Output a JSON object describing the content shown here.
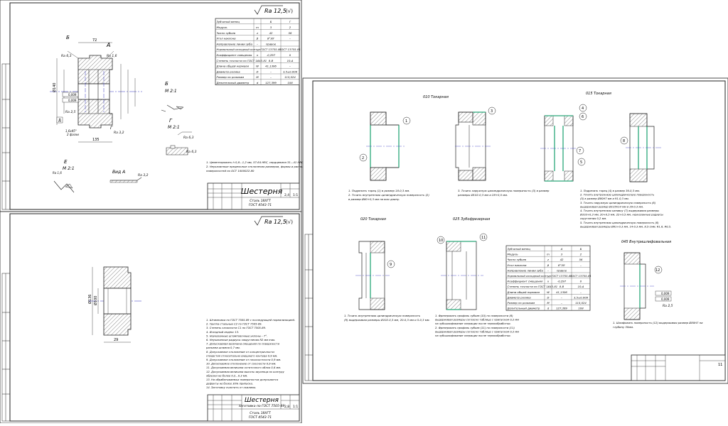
{
  "sheet1": {
    "roughness": "Ra 12,5",
    "roughness_paren": "(√)",
    "gear_table": {
      "header": [
        "Зубчатый венец",
        "",
        "Б",
        "Г"
      ],
      "rows": [
        [
          "Модуль",
          "m",
          "3",
          "2"
        ],
        [
          "Число зубьев",
          "z",
          "42",
          "56"
        ],
        [
          "Угол наклона",
          "β",
          "8°30'",
          "–"
        ],
        [
          "Направление линии зуба",
          "–",
          "правое",
          ""
        ],
        [
          "Нормальный исходный контур",
          "–",
          "ГОСТ 13755-81",
          "ГОСТ 13755-81"
        ],
        [
          "Коэффициент смещения",
          "x",
          "-0,297",
          "0"
        ],
        [
          "Степень точности по ГОСТ 1643-81",
          "–",
          "8-В",
          "10-А"
        ],
        [
          "Длина общей нормали",
          "W",
          "41,1306",
          "–"
        ],
        [
          "Диаметр ролика",
          "D",
          "–",
          "3,5±0,009"
        ],
        [
          "Размер по роликам",
          "M",
          "–",
          "115,024"
        ],
        [
          "Делительный диаметр",
          "d",
          "127,399",
          "108"
        ]
      ]
    },
    "labels": {
      "view_b": "Б",
      "view_a": "А",
      "section_g": "Г",
      "m21_1": "М 2:1",
      "m21_2": "М 2:1",
      "m21_3": "М 2:1",
      "view_b_label": "Вид А",
      "view_d": "Д",
      "view_e": "Е",
      "ra63": "Ra 6,3",
      "ra32": "Ra 3,2",
      "ra25": "Ra 2,5",
      "ra16": "Ra 1,6",
      "dim_72": "72",
      "dim_1": "1",
      "dim_16": "16",
      "dim_135": "135",
      "dim_140": "Ø140",
      "tol_1": "0,009",
      "tol_2": "0,009",
      "chamfer": "1,6х45°",
      "chamfer2": "2 фаски"
    },
    "notes": [
      "1. Цементировать h 0,8...1,2 мм, 57-64 HRC, сердцевина 31...41 HRC.",
      "2. Неуказанные предельные отклонения размеров, формы и расположения",
      "   поверхностей по ОСТ 1000022-80"
    ],
    "title_block": {
      "name": "Шестерня",
      "material": "Сталь 18ХГТ",
      "standard": "ГОСТ 4543-71",
      "mass": "2,4",
      "scale": "1:1"
    }
  },
  "sheet2": {
    "roughness": "Ra 12,5",
    "roughness_paren": "(√)",
    "dims": {
      "d1": "Ø136",
      "d2": "Ø100",
      "w": "29"
    },
    "notes": [
      "1. Штамповка по ГОСТ 7505-89 с последующей нормализацией.",
      "2. Группа стальных С2 по ГОСТ 7505-89.",
      "3. Степень сложности С1 по ГОСТ 7505-89.",
      "4. Исходный индекс 13.",
      "5. Неуказанные штамповочные уклоны – 7°.",
      "6. Неуказанные радиусы закругления R2 мм max.",
      "7. Допускаемая величина смещения по поверхности",
      "   разъема штампа 0,7 мм.",
      "8. Допускаемое отклонение от концентричности",
      "   отверстия относительно внешнего контура 0,9 мм.",
      "9. Допускаемое отклонение от плоскостности 0,9 мм.",
      "10. Допускаемое отклонение от соосности 0,9 мм.",
      "11. Допускаемая величина остаточного облоя 0,6 мм.",
      "12. Допускаемая величина высоты заусенца по контуру",
      "    обрезки не более 0,2...0,3 мм.",
      "13. На обрабатываемых поверхностях допускаются",
      "    дефекты не более 30% припуска.",
      "14. Заготовку очистить от окалины."
    ],
    "title_block": {
      "name": "Шестерня",
      "subtitle": "заготовка по ГОСТ 7505-89",
      "material": "Сталь 18ХГТ",
      "standard": "ГОСТ 4543-71",
      "mass": "2,8",
      "scale": "1:1"
    }
  },
  "sheet3": {
    "ops": {
      "op010": "010 Токарная",
      "op015": "015 Токарная",
      "op020": "020 Токарная",
      "op025": "025 Зубофрезерная",
      "op045": "045 Внутришлифовальная"
    },
    "op010_text": [
      "1. Подрезать торец (1) в размер 18-0,3 мм.",
      "2. Точить внутреннюю цилиндрическую поверхность (2)",
      "в размер Ø80+0,3 мм на всю длину."
    ],
    "op010b_text": [
      "3. Точить наружную цилиндрическую поверхность (3) в размер",
      "размеры Ø102-0,3 мм и 28+0,5 мм."
    ],
    "op015_text": [
      "1. Подрезать торец (4) в размер 36-0,3 мм.",
      "2. Точить внутреннюю цилиндрическую поверхность",
      "(5) в размер Ø80Н7 мм и 91-0,3 мм.",
      "3. Точить наружную цилиндрическую поверхность (6)",
      "выдерживая размер Ø135h14 мм и 29-0,3 мм.",
      "4. Точить внутреннюю канавку (7) выдерживая размеры",
      "Ø103+0,3 мм, 20+0,5 мм, 22+0,5 мм, неуказанные радиусы",
      "скругления 0,2 мм.",
      "5. Точить внутреннюю цилиндрическую поверхность (8)",
      "выдерживая размеры Ø91+0,3 мм, 14-0,3 мм, 8,5-1мм, R1,6, R0,5."
    ],
    "op020_text": [
      "1. Точить внутреннюю цилиндрическую поверхность",
      "(9) выдерживая размеры Ø102-0,3 мм, 20-0,3 мм и 5-0,3 мм."
    ],
    "op025_text": [
      "1. Фрезеровать профиль зубьев (10) по поверхности (8)",
      "выдерживая размеры согласно таблице с припуском 0,2 мм",
      "на зубошлифование операции после термообработки.",
      "2. Фрезеровать профиль зубьев (11) по поверхности (11)",
      "выдерживая размеры согласно таблице с припуском 0,2 мм",
      "на зубошлифование операции после термообработки."
    ],
    "op045_text": [
      "1. Шлифовать поверхность (12) выдерживая размер Ø80Н7 на",
      "глубину 30мм."
    ],
    "markers": [
      "1",
      "2",
      "3",
      "4",
      "5",
      "6",
      "7",
      "8",
      "9",
      "10",
      "11",
      "12"
    ],
    "gear_table": {
      "header": [
        "Зубчатый венец",
        "",
        "А",
        "Б"
      ],
      "rows": [
        [
          "Модуль",
          "m",
          "3",
          "2"
        ],
        [
          "Число зубьев",
          "z",
          "42",
          "56"
        ],
        [
          "Угол наклона",
          "β",
          "8°30'",
          "–"
        ],
        [
          "Направление линии зуба",
          "–",
          "правое",
          ""
        ],
        [
          "Нормальный исходный контур",
          "–",
          "ГОСТ 13755-81",
          "ГОСТ 13755-81"
        ],
        [
          "Коэффициент смещения",
          "x",
          "-0,297",
          "0"
        ],
        [
          "Степень точности по ГОСТ 1643-81",
          "–",
          "8-В",
          "10-А"
        ],
        [
          "Длина общей нормали",
          "W",
          "41,1306",
          "–"
        ],
        [
          "Диаметр ролика",
          "D",
          "–",
          "3,5±0,009"
        ],
        [
          "Размер по роликам",
          "M",
          "–",
          "115,024"
        ],
        [
          "Делительный диаметр",
          "d",
          "127,399",
          "108"
        ]
      ]
    },
    "tol_1": "0,009",
    "tol_2": "0,009",
    "ra25": "Ra 2,5",
    "title_block": {
      "sheet": "11"
    }
  },
  "colors": {
    "line": "#1a1a1a",
    "center": "#3030c0",
    "hatch": "#444444",
    "highlight": "#2aa879",
    "sheet_bg": "#ffffff"
  }
}
